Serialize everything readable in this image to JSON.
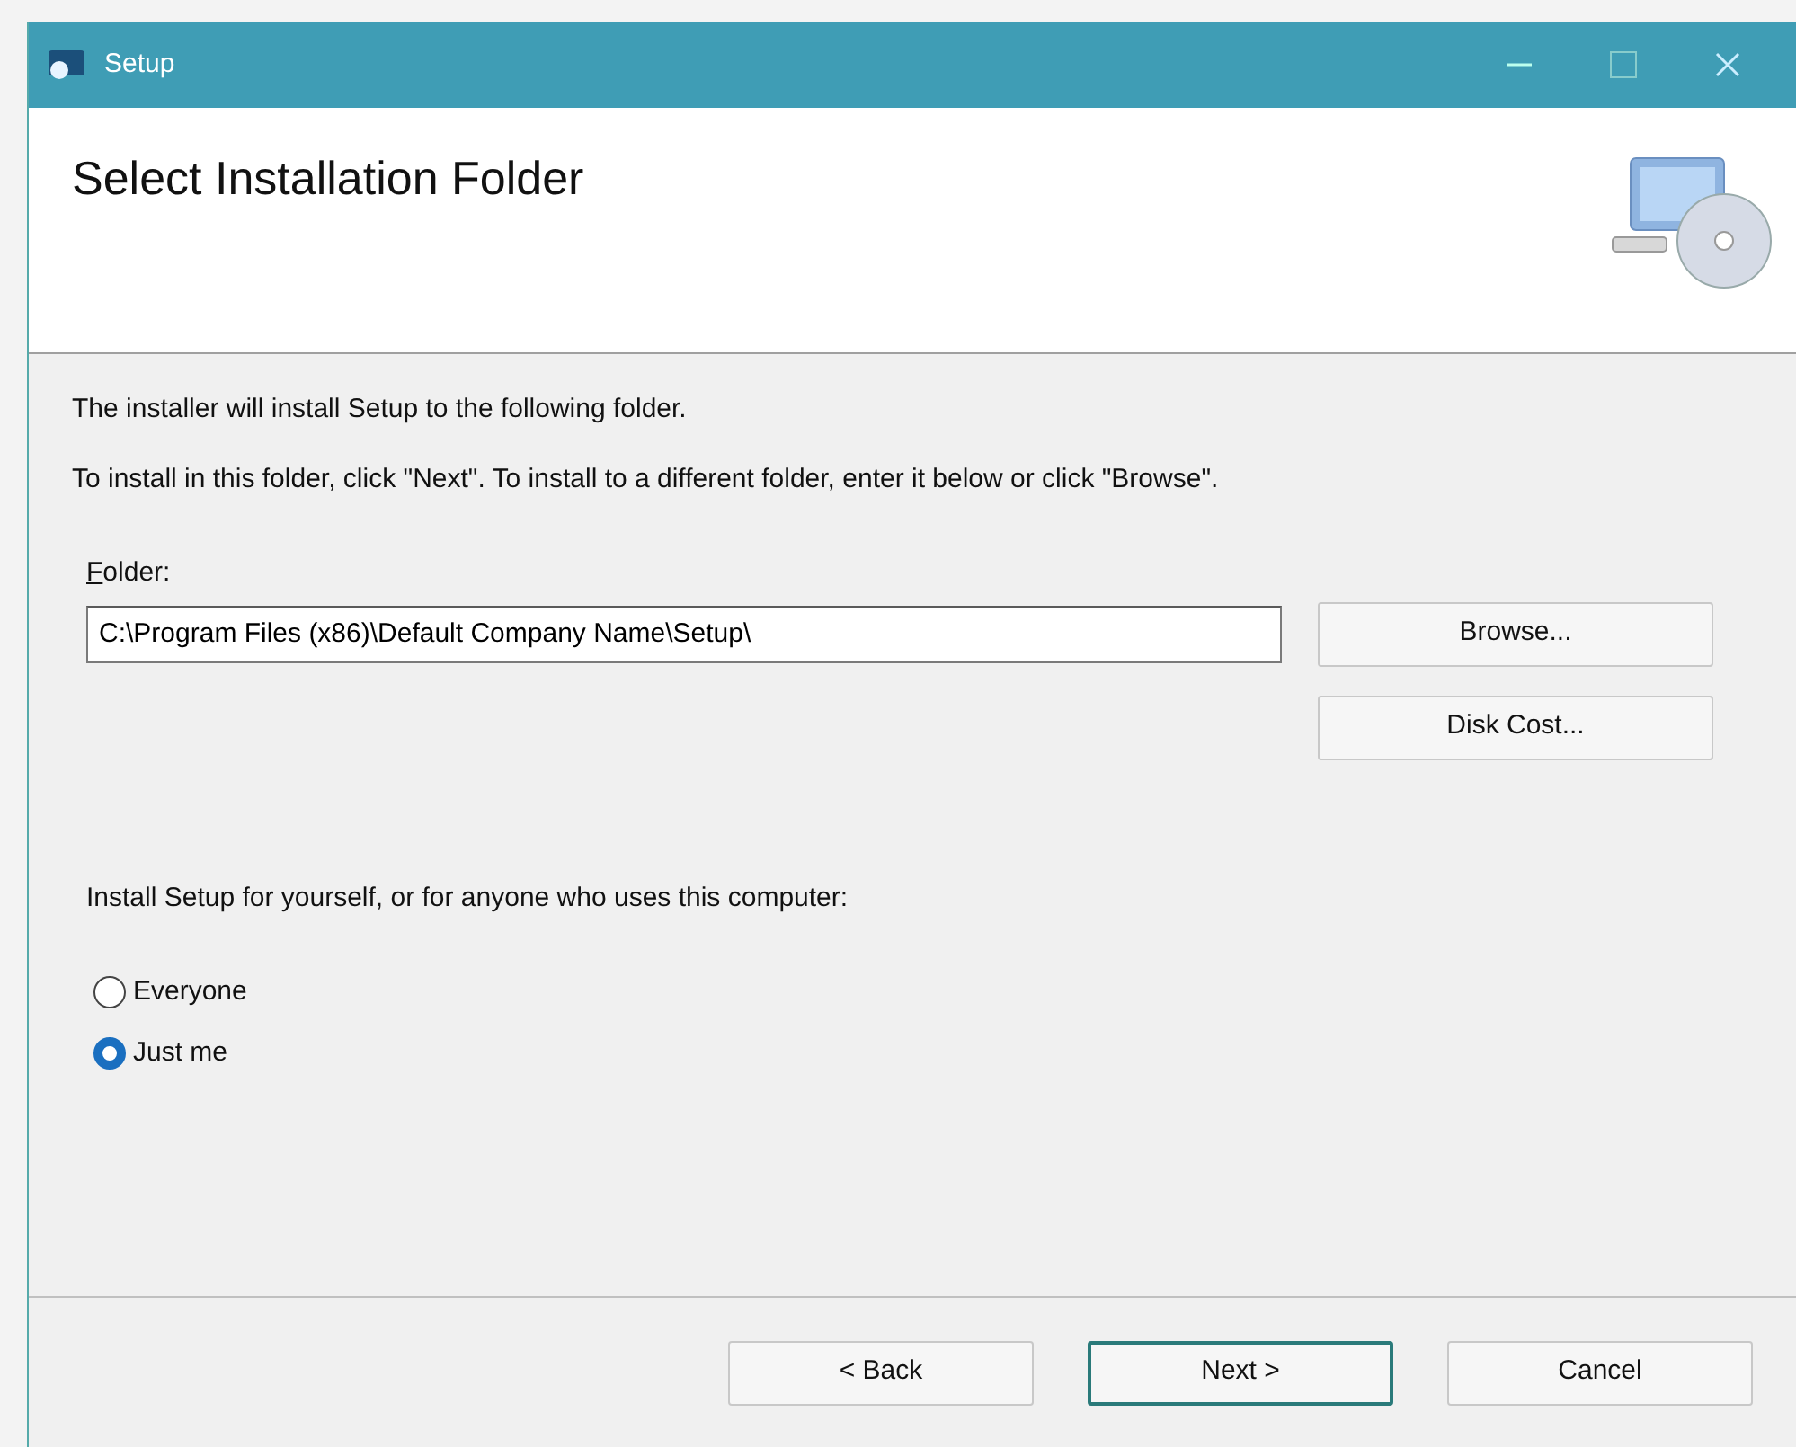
{
  "window": {
    "title": "Setup"
  },
  "header": {
    "title": "Select Installation Folder"
  },
  "intro": [
    "The installer will install Setup to the following folder.",
    "To install in this folder, click \"Next\". To install to a different folder, enter it below or click \"Browse\"."
  ],
  "folder": {
    "label": "Folder:",
    "value": "C:\\Program Files (x86)\\Default Company Name\\Setup\\"
  },
  "side_buttons": [
    "Browse...",
    "Disk Cost..."
  ],
  "scope": {
    "prompt": "Install Setup for yourself, or for anyone who uses this computer:",
    "options": [
      {
        "label": "Everyone",
        "selected": false
      },
      {
        "label": "Just me",
        "selected": true
      }
    ]
  },
  "buttons": [
    {
      "label": "< Back",
      "default": false
    },
    {
      "label": "Next >",
      "default": true
    },
    {
      "label": "Cancel",
      "default": false
    }
  ]
}
